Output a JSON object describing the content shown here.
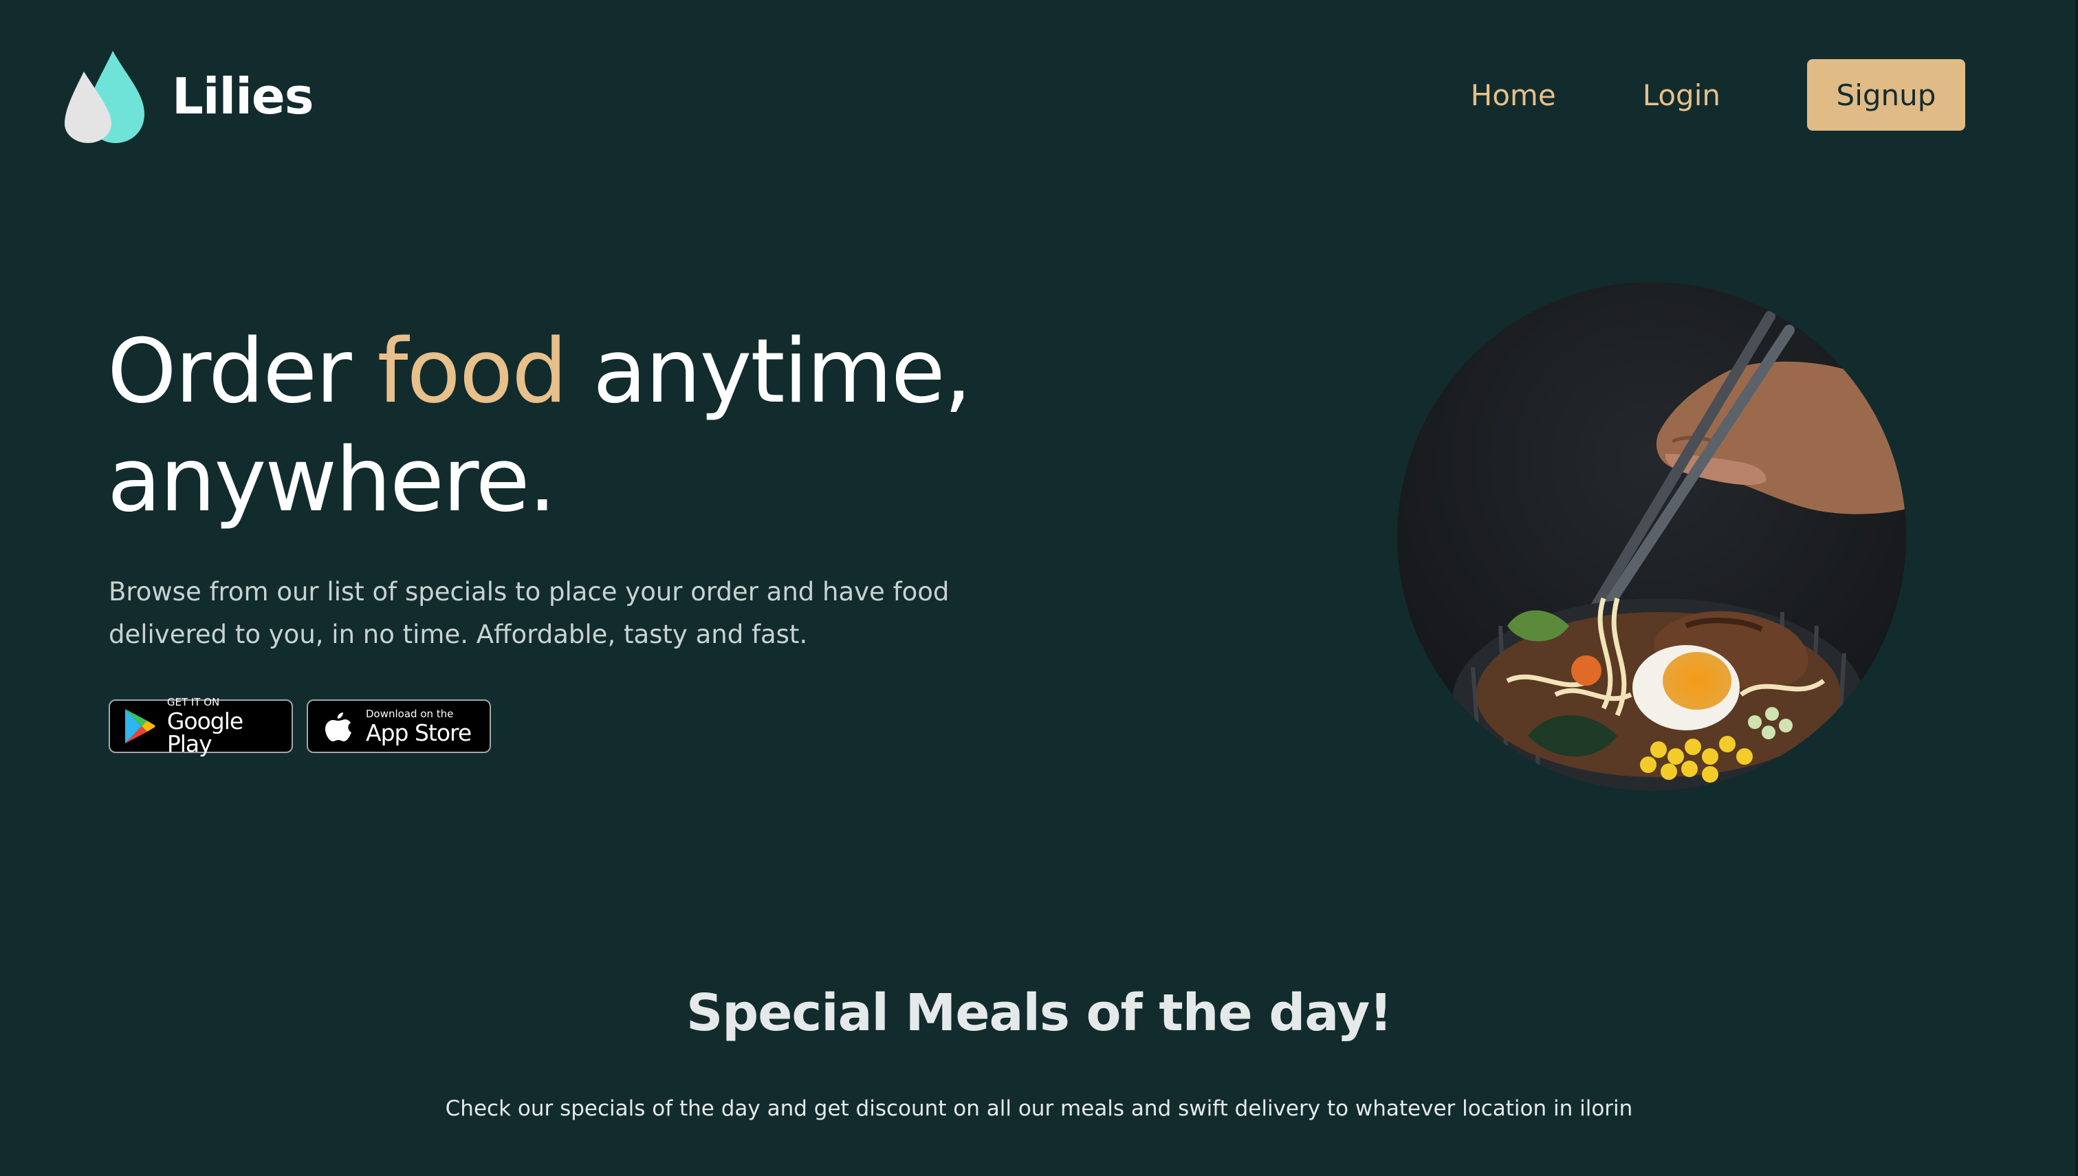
{
  "brand": {
    "name": "Lilies",
    "logo_icon": "water-drop-icon",
    "logo_colors": [
      "#6fe3d8",
      "#e4e4e4"
    ]
  },
  "nav": {
    "home": "Home",
    "login": "Login",
    "signup": "Signup"
  },
  "hero": {
    "title_part1": "Order ",
    "title_accent": "food",
    "title_part2": " anytime,",
    "title_line2": "anywhere.",
    "subtitle_line1": "Browse from our list of specials to place your order and have food",
    "subtitle_line2": "delivered to you, in no time. Affordable, tasty and fast.",
    "image_icon": "ramen-bowl-image"
  },
  "stores": {
    "google": {
      "small": "GET IT ON",
      "big": "Google Play",
      "icon": "google-play-icon"
    },
    "apple": {
      "small": "Download on the",
      "big": "App Store",
      "icon": "apple-icon"
    }
  },
  "specials": {
    "title": "Special Meals of the day!",
    "subtitle": "Check our specials of the day and get discount on all our meals and swift delivery to whatever location in ilorin"
  },
  "colors": {
    "background": "#122c2e",
    "accent": "#e8c08b",
    "button": "#e0bb86",
    "text": "#ffffff",
    "muted": "#c9d3d2"
  }
}
